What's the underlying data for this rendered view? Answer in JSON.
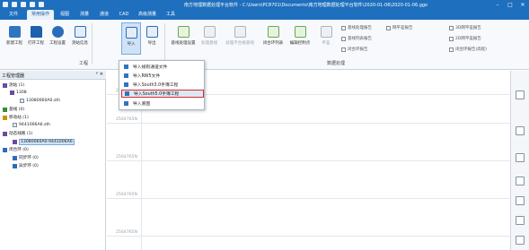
{
  "window": {
    "title": "南方地理数据处理平台软件 - C:\\Users\\PC8701\\Documents\\南方地理数据处理平台软件\\2020-01-06\\2020-01-06.ggo",
    "controls": [
      "–",
      "□",
      "✕"
    ]
  },
  "menu": {
    "tabs": [
      "文件",
      "常用操作",
      "视图",
      "测量",
      "通道",
      "CAD",
      "高级测量",
      "工具"
    ],
    "active": "常用操作"
  },
  "ribbon": {
    "buttons": {
      "new": "新建工程",
      "open": "打开工程",
      "settings": "工程设置",
      "station_info": "测站信息",
      "import": "导入",
      "export": "导出",
      "leveling": "基线处理设置",
      "process_line": "处理基线",
      "process_bad": "处理不合格基线",
      "loop_list": "闭合环列表",
      "edit_ctrl": "编辑控制点",
      "adjust": "平差"
    },
    "groups": {
      "project": "工程",
      "processing": "数据处理"
    },
    "checks": {
      "baseline_report": "基线处理报告",
      "adjust_report": "网平差报告",
      "baseline_list": "基线列表报告",
      "loop_report": "闭合环报告",
      "report_3d": "3D网平差报告",
      "report_2d": "2D网平差报告",
      "report_loop_height": "闭合环报告(高程)"
    }
  },
  "panel": {
    "title": "工程管理器",
    "pin": "ᵖ ✕"
  },
  "tree": [
    {
      "label": "测站 (1)"
    },
    {
      "label": "1308"
    },
    {
      "label": "13080060A0.sth"
    },
    {
      "label": "基线 (0)"
    },
    {
      "label": "移动站 (1)"
    },
    {
      "label": "9441006A6.sth"
    },
    {
      "label": "动态线路 (1)"
    },
    {
      "label": "13080060A0-9441006A6"
    },
    {
      "label": "闭合环 (0)"
    },
    {
      "label": "同步环 (0)"
    },
    {
      "label": "异步环 (0)"
    }
  ],
  "canvas": {
    "y_labels": [
      "2564770N",
      "2564765N",
      "2564765N",
      "2564765N",
      "2564765N"
    ]
  },
  "dropdown": {
    "items": [
      "导入规则通道文件",
      "导入RW5文件",
      "导入South3.0手簿工程",
      "导入South5.0手簿工程",
      "导入底图"
    ],
    "highlighted_index": 3
  }
}
